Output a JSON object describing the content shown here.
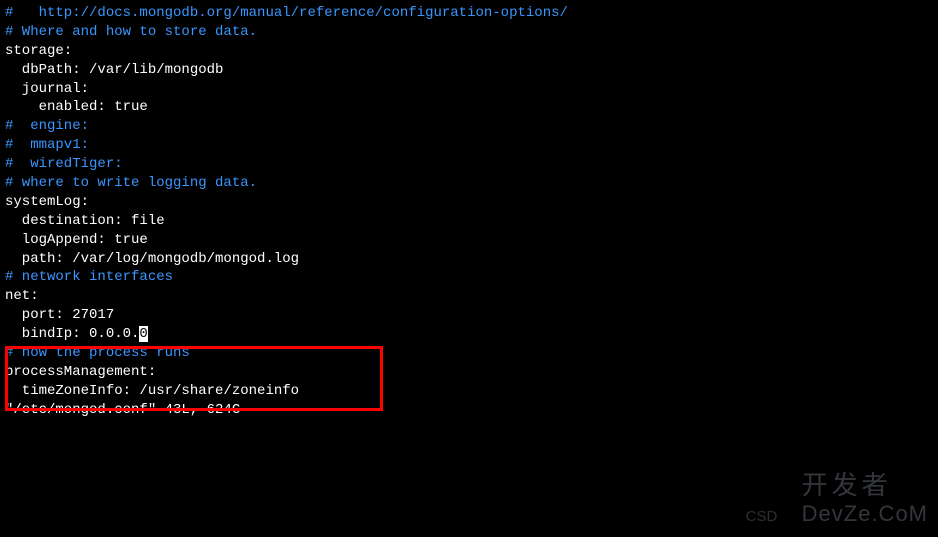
{
  "lines": {
    "l1": "#   http://docs.mongodb.org/manual/reference/configuration-options/",
    "l2": "",
    "l3": "# Where and how to store data.",
    "l4": "storage:",
    "l5": "  dbPath: /var/lib/mongodb",
    "l6": "  journal:",
    "l7": "    enabled: true",
    "l8": "#  engine:",
    "l9": "#  mmapv1:",
    "l10": "#  wiredTiger:",
    "l11": "",
    "l12": "# where to write logging data.",
    "l13": "systemLog:",
    "l14": "  destination: file",
    "l15": "  logAppend: true",
    "l16": "  path: /var/log/mongodb/mongod.log",
    "l17": "",
    "l18": "# network interfaces",
    "l19": "net:",
    "l20": "  port: 27017",
    "l21a": "  bindIp: 0.0.0.",
    "l21b": "0",
    "l22": "",
    "l23": "",
    "l24": "# how the process runs",
    "l25": "processManagement:",
    "l26": "  timeZoneInfo: /usr/share/zoneinfo",
    "l27": "\"/etc/mongod.conf\" 43L, 624C"
  },
  "watermark": {
    "csdn": "CSD",
    "zh": "开发者",
    "en": "DevZe.CoM"
  }
}
